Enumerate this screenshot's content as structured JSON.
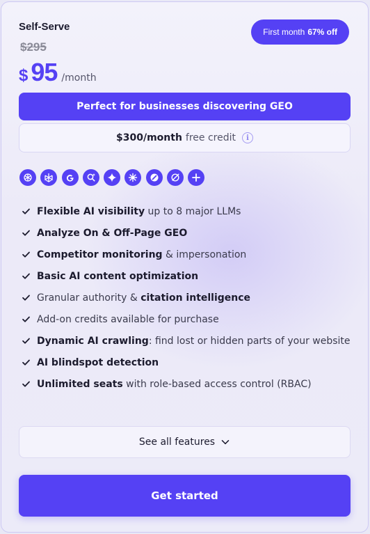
{
  "plan": {
    "name": "Self-Serve",
    "old_price": "$295",
    "currency": "$",
    "price": "95",
    "period": "/month"
  },
  "promo": {
    "prefix": "First month",
    "discount": "67% off"
  },
  "headline": "Perfect for businesses discovering GEO",
  "credit": {
    "amount": "$300/month",
    "rest": "free credit",
    "info_icon": "info-icon"
  },
  "llm_icons": [
    "chatgpt-icon",
    "perplexity-icon",
    "google-icon",
    "google-ai-overview-icon",
    "gemini-icon",
    "claude-icon",
    "copilot-icon",
    "grok-icon",
    "add-icon"
  ],
  "features": [
    {
      "bold": "Flexible AI visibility",
      "rest": " up to 8 major LLMs",
      "bold_first": true
    },
    {
      "bold": "Analyze On & Off-Page GEO",
      "rest": "",
      "bold_first": true
    },
    {
      "bold": "Competitor monitoring",
      "rest": " & impersonation",
      "bold_first": true
    },
    {
      "bold": "Basic AI content optimization",
      "rest": "",
      "bold_first": true
    },
    {
      "bold": "citation intelligence",
      "rest": "Granular authority & ",
      "bold_first": false
    },
    {
      "bold": "",
      "rest": "Add-on credits available for purchase",
      "bold_first": true
    },
    {
      "bold": "Dynamic AI crawling",
      "rest": ": find lost or hidden parts of your website",
      "bold_first": true
    },
    {
      "bold": "AI blindspot detection",
      "rest": "",
      "bold_first": true
    },
    {
      "bold": "Unlimited seats",
      "rest": " with role-based access control (RBAC)",
      "bold_first": true
    }
  ],
  "see_all_label": "See all features",
  "cta_label": "Get started",
  "colors": {
    "accent": "#5541f4",
    "background": "#eceaf8",
    "text": "#1c1b2e"
  }
}
